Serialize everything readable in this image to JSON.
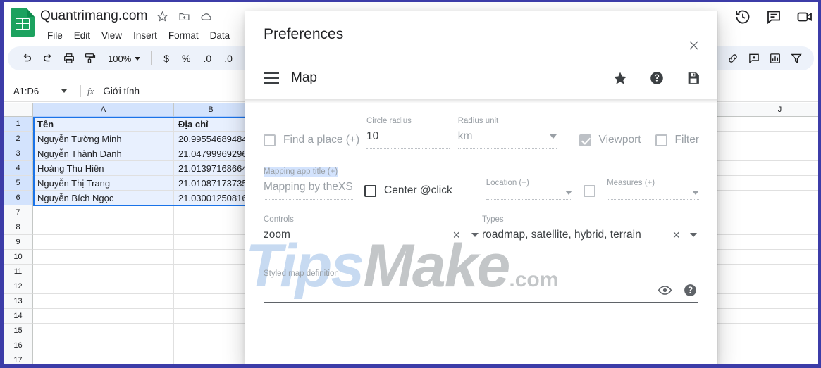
{
  "sheets": {
    "doc_title": "Quantrimang.com",
    "title_icons": [
      "star-icon",
      "move-to-folder-icon",
      "cloud-saved-icon"
    ],
    "menus": [
      "File",
      "Edit",
      "View",
      "Insert",
      "Format",
      "Data"
    ],
    "top_right_icons": [
      "version-history-icon",
      "comment-icon",
      "meet-video-icon"
    ],
    "toolbar": {
      "icons": [
        "undo-icon",
        "redo-icon",
        "print-icon",
        "paint-format-icon"
      ],
      "zoom": "100%",
      "currency": "$",
      "percent": "%",
      "decrease_decimal": ".0",
      "increase_decimal": ".0",
      "right_icons": [
        "insert-link-icon",
        "insert-comment-icon",
        "insert-chart-icon",
        "filter-icon"
      ]
    },
    "formula_bar": {
      "name_box": "A1:D6",
      "fx_label": "fx",
      "value": "Giới tính"
    },
    "grid": {
      "columns": [
        "A",
        "B",
        "J"
      ],
      "rows": [
        "1",
        "2",
        "3",
        "4",
        "5",
        "6",
        "7",
        "8",
        "9",
        "10",
        "11",
        "12",
        "13",
        "14",
        "15",
        "16",
        "17"
      ],
      "col_a": [
        "Tên",
        "Nguyễn Tường Minh",
        "Nguyễn Thành Danh",
        "Hoàng Thu Hiền",
        "Nguyễn Thị Trang",
        "Nguyễn Bích Ngọc"
      ],
      "col_b": [
        "Địa chỉ",
        "20.99554689484",
        "21.04799969296",
        "21.01397168664",
        "21.01087173735",
        "21.03001250816"
      ]
    }
  },
  "watermark": {
    "tips": "Tips",
    "make": "Make",
    "com": ".com"
  },
  "dialog": {
    "title": "Preferences",
    "close_icon": "close-icon",
    "section": {
      "menu_icon": "hamburger-menu-icon",
      "title": "Map",
      "actions": [
        "star-icon",
        "help-icon",
        "save-icon"
      ]
    },
    "form": {
      "find_a_place": {
        "checkbox_checked": false,
        "label": "Find a place (+)"
      },
      "circle_radius": {
        "label": "Circle radius",
        "value": "10"
      },
      "radius_unit": {
        "label": "Radius unit",
        "value": "km"
      },
      "viewport": {
        "checkbox_checked": true,
        "label": "Viewport"
      },
      "filter": {
        "checkbox_checked": false,
        "label": "Filter"
      },
      "mapping_app_title": {
        "label": "Mapping app title (+)",
        "value": "Mapping by theXS"
      },
      "center_at_click": {
        "checkbox_checked": false,
        "label": "Center @click"
      },
      "location": {
        "label": "Location (+)",
        "value": ""
      },
      "measures": {
        "label": "Measures (+)",
        "value": "",
        "checkbox_checked": false
      },
      "controls": {
        "label": "Controls",
        "value": "zoom",
        "clear": "×"
      },
      "types": {
        "label": "Types",
        "value": "roadmap, satellite, hybrid, terrain",
        "clear": "×"
      },
      "styled_map_definition": {
        "label": "Styled map definition",
        "value": "",
        "icons": [
          "eye-icon",
          "help-icon"
        ]
      }
    }
  },
  "colors": {
    "sheets_green": "#1ca25f",
    "toolbar_bg": "#edf2fa",
    "selection_blue": "#1a73e8",
    "selected_cell_bg": "#e8f0fe",
    "browser_chrome": "#3c3ca8",
    "muted_text": "#9aa0a6"
  }
}
